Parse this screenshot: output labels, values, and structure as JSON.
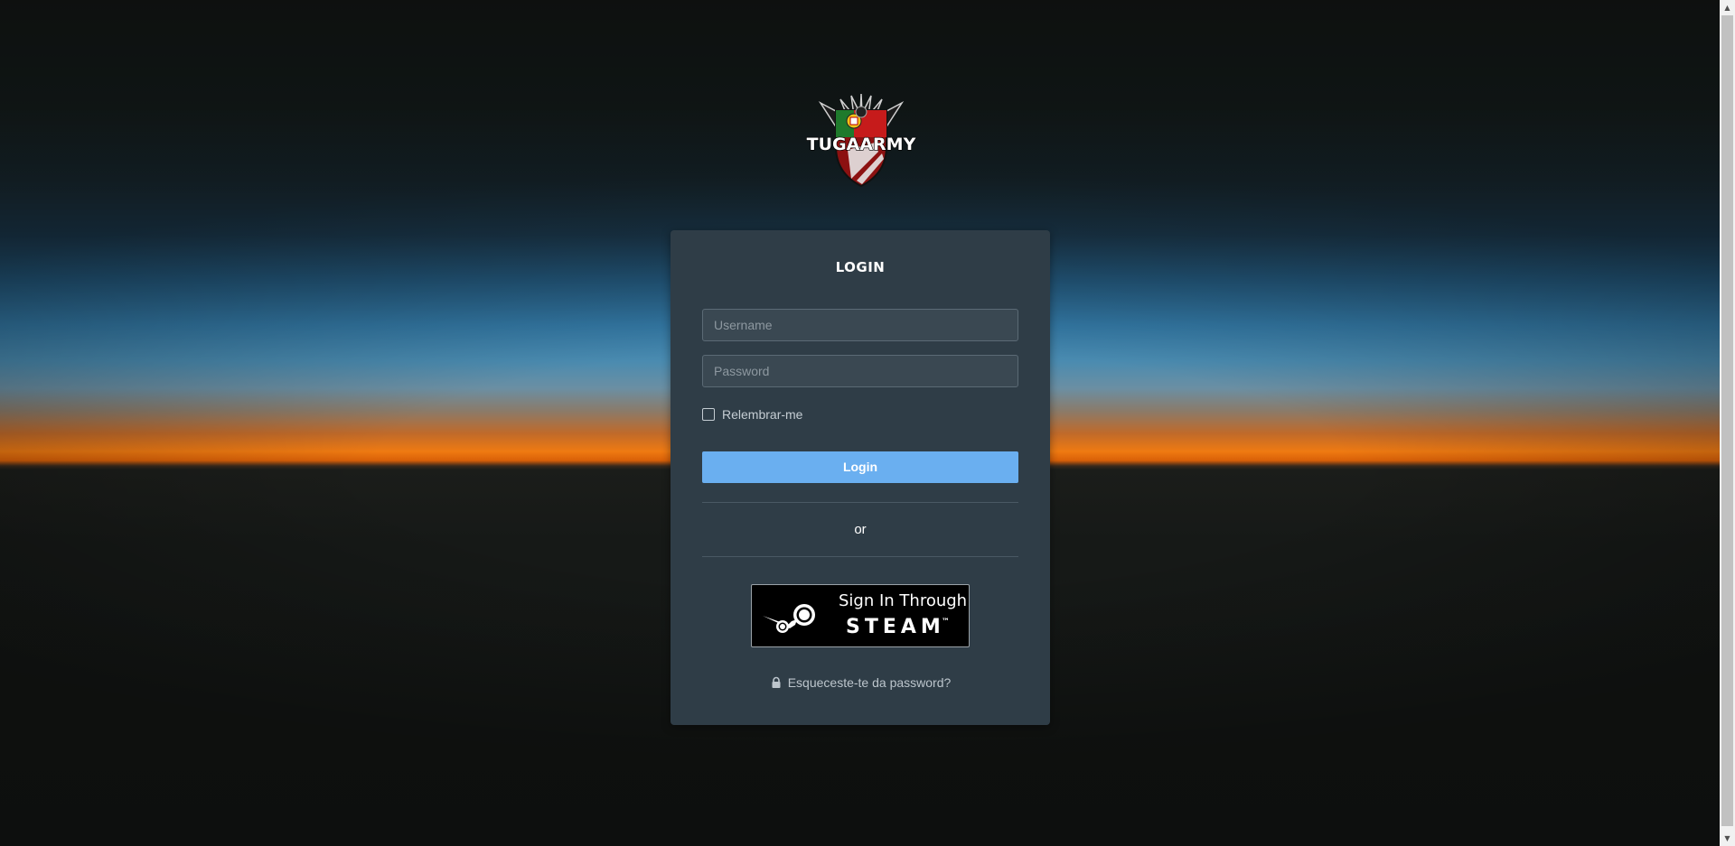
{
  "logo": {
    "text": "TUGAARMY",
    "icon": "eagle-shield-logo-icon"
  },
  "login_panel": {
    "title": "LOGIN",
    "username": {
      "placeholder": "Username",
      "value": ""
    },
    "password": {
      "placeholder": "Password",
      "value": ""
    },
    "remember": {
      "label": "Relembrar-me",
      "checked": false
    },
    "login_button": "Login",
    "separator_text": "or",
    "steam_button": {
      "line1": "Sign In Through",
      "line2": "STEAM",
      "trademark": "™",
      "icon": "steam-icon"
    },
    "forgot_password": {
      "label": "Esqueceste-te da password?",
      "icon": "lock-icon"
    }
  },
  "colors": {
    "panel_background": "#2f3d47",
    "login_button": "#6aaff0",
    "page_background": "#141715",
    "horizon_orange": "#ef7a12",
    "sky_blue": "#3378a4"
  },
  "scrollbar": {
    "up_icon": "scroll-up-arrow-icon",
    "down_icon": "scroll-down-arrow-icon"
  }
}
